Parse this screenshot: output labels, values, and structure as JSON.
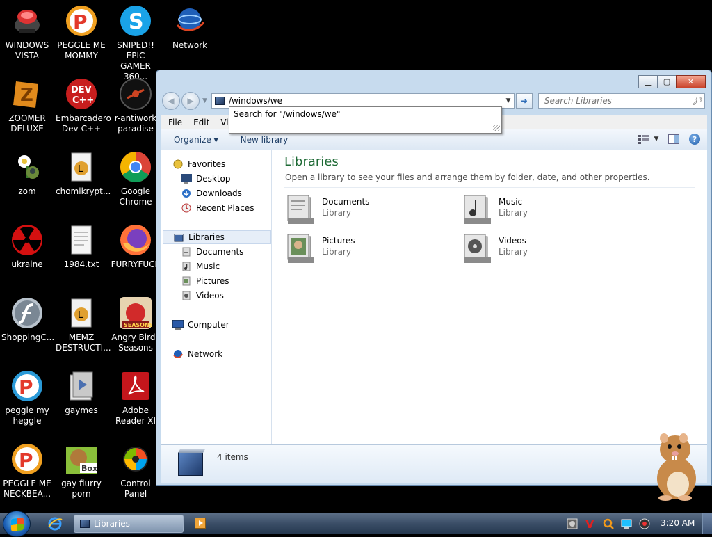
{
  "desktop": {
    "icons": [
      {
        "label": "WINDOWS VISTA",
        "icon": "vista-bot-icon"
      },
      {
        "label": "PEGGLE ME MOMMY",
        "icon": "peggle-icon"
      },
      {
        "label": "SNIPED!! EPIC GAMER 360...",
        "icon": "skype-icon"
      },
      {
        "label": "Network",
        "icon": "network-globe-icon"
      },
      {
        "label": "ZOOMER DELUXE",
        "icon": "zoomer-icon"
      },
      {
        "label": "Embarcadero Dev-C++",
        "icon": "devcpp-icon"
      },
      {
        "label": "r-antiwork paradise",
        "icon": "antiwork-icon"
      },
      {
        "label": "zom",
        "icon": "zombie-flower-icon"
      },
      {
        "label": "chomikrypt...",
        "icon": "shortcut-file-icon"
      },
      {
        "label": "Google Chrome",
        "icon": "chrome-icon"
      },
      {
        "label": "ukraine",
        "icon": "radiation-icon"
      },
      {
        "label": "1984.txt",
        "icon": "text-file-icon"
      },
      {
        "label": "FURRYFUCK",
        "icon": "firefox-icon"
      },
      {
        "label": "ShoppingC...",
        "icon": "flash-icon"
      },
      {
        "label": "MEMZ DESTRUCTI...",
        "icon": "shortcut-file-icon"
      },
      {
        "label": "Angry Birds Seasons",
        "icon": "angry-birds-icon"
      },
      {
        "label": "peggle my heggle",
        "icon": "peggle-icon"
      },
      {
        "label": "gaymes",
        "icon": "folder-icon"
      },
      {
        "label": "Adobe Reader XI",
        "icon": "adobe-reader-icon"
      },
      {
        "label": "PEGGLE ME NECKBEA...",
        "icon": "peggle-icon"
      },
      {
        "label": "gay fiurry porn",
        "icon": "gopher-box-icon"
      },
      {
        "label": "Control Panel",
        "icon": "control-panel-icon"
      }
    ]
  },
  "window": {
    "address_value": "/windows/we",
    "search_placeholder": "Search Libraries",
    "suggestion": "Search for \"/windows/we\"",
    "menu": [
      "File",
      "Edit",
      "View"
    ],
    "toolbar": {
      "organize": "Organize ▾",
      "new_library": "New library"
    },
    "nav": {
      "favorites": "Favorites",
      "desktop": "Desktop",
      "downloads": "Downloads",
      "recent": "Recent Places",
      "libraries": "Libraries",
      "documents": "Documents",
      "music": "Music",
      "pictures": "Pictures",
      "videos": "Videos",
      "computer": "Computer",
      "network": "Network"
    },
    "content": {
      "title": "Libraries",
      "subtitle": "Open a library to see your files and arrange them by folder, date, and other properties.",
      "libraries": [
        {
          "name": "Documents",
          "type": "Library"
        },
        {
          "name": "Music",
          "type": "Library"
        },
        {
          "name": "Pictures",
          "type": "Library"
        },
        {
          "name": "Videos",
          "type": "Library"
        }
      ]
    },
    "details": {
      "count": "4 items"
    }
  },
  "taskbar": {
    "task_label": "Libraries",
    "clock": "3:20 AM"
  },
  "colors": {
    "library_title": "#1e6a35",
    "taskbar": "#3a4d66",
    "command_bar_text": "#1e3e66"
  }
}
